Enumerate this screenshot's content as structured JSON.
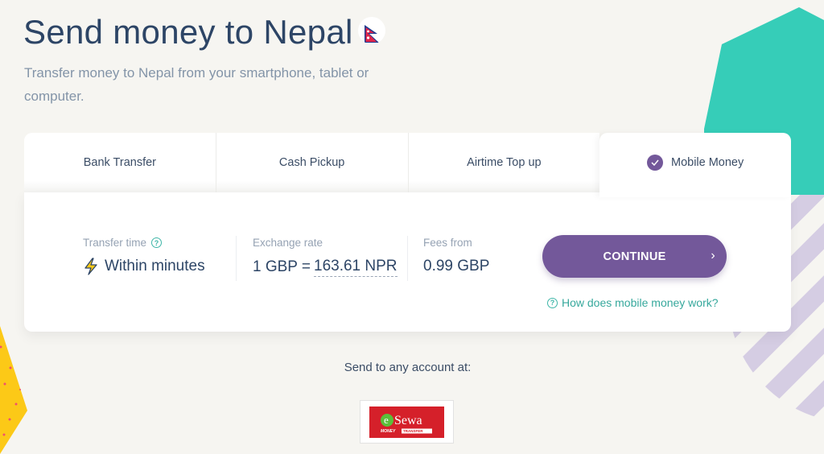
{
  "header": {
    "title": "Send money to Nepal",
    "flag_icon": "nepal-flag",
    "subtitle": "Transfer money to Nepal from your smartphone, tablet or computer."
  },
  "tabs": [
    {
      "label": "Bank Transfer",
      "active": false
    },
    {
      "label": "Cash Pickup",
      "active": false
    },
    {
      "label": "Airtime Top up",
      "active": false
    },
    {
      "label": "Mobile Money",
      "active": true,
      "icon": "check-circle-icon"
    }
  ],
  "details": {
    "transfer_time": {
      "label": "Transfer time",
      "value": "Within minutes",
      "icon": "lightning-icon",
      "help_icon": "question-circle-icon"
    },
    "exchange_rate": {
      "label": "Exchange rate",
      "prefix": "1 GBP =",
      "value": "163.61 NPR"
    },
    "fees": {
      "label": "Fees from",
      "value": "0.99 GBP"
    }
  },
  "actions": {
    "continue_label": "CONTINUE",
    "continue_icon": "chevron-right-icon",
    "help_link": "How does mobile money work?"
  },
  "partners": {
    "heading": "Send to any account at:",
    "logos": [
      {
        "name": "eSewa",
        "tagline_left": "MONEY",
        "tagline_right": "TRANSFER"
      }
    ]
  },
  "colors": {
    "primary_purple": "#73589a",
    "teal": "#36cdb8",
    "link_teal": "#36a89c",
    "title_navy": "#2d4566",
    "background": "#f6f5f1"
  }
}
